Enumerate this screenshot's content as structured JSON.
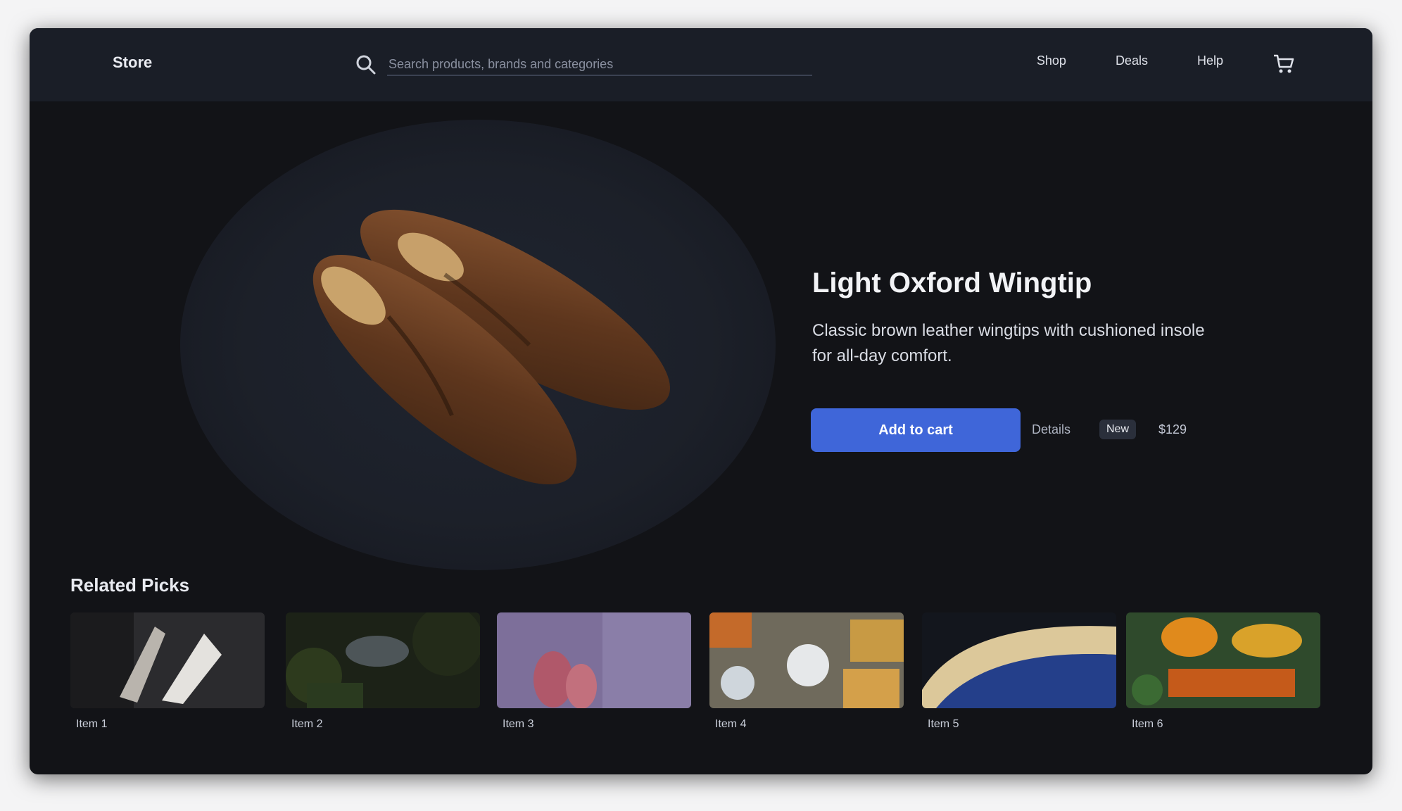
{
  "nav": {
    "brand": "Store",
    "search_placeholder": "Search products, brands and categories",
    "links": [
      "Shop",
      "Deals",
      "Help"
    ]
  },
  "product": {
    "title": "Light Oxford Wingtip",
    "description": "Classic brown leather wingtips with cushioned insole for all-day comfort.",
    "cta_label": "Add to cart",
    "secondary_label": "Details",
    "badge": "New",
    "price": "$129"
  },
  "related": {
    "title": "Related Picks",
    "items": [
      {
        "caption": "Item 1"
      },
      {
        "caption": "Item 2"
      },
      {
        "caption": "Item 3"
      },
      {
        "caption": "Item 4"
      },
      {
        "caption": "Item 5"
      },
      {
        "caption": "Item 6"
      }
    ]
  },
  "colors": {
    "background": "#121317",
    "nav": "#1a1e27",
    "accent": "#3f66d9",
    "leather": "#6b3f22"
  }
}
